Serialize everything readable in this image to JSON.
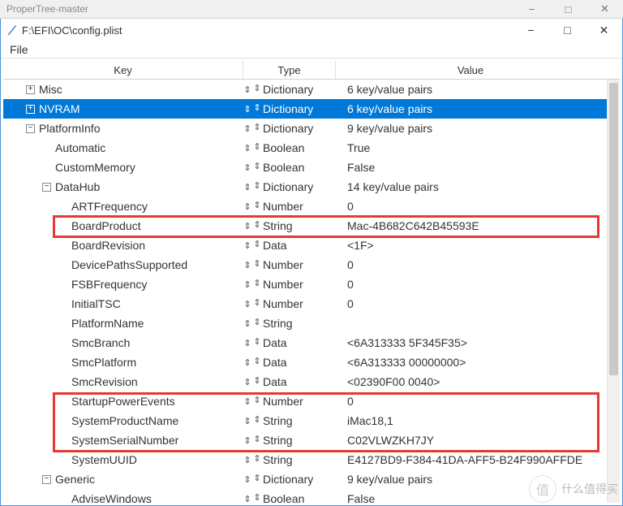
{
  "outer": {
    "title": "ProperTree-master"
  },
  "app": {
    "title": "F:\\EFI\\OC\\config.plist",
    "menu_file": "File"
  },
  "header": {
    "key": "Key",
    "type": "Type",
    "value": "Value"
  },
  "types": {
    "dict": "Dictionary",
    "bool": "Boolean",
    "str": "String",
    "num": "Number",
    "data": "Data"
  },
  "glyph": {
    "sort": "⇕",
    "menu": "≡",
    "plus": "+",
    "minus": "−",
    "min": "−",
    "sq": "□",
    "close": "✕"
  },
  "rows": [
    {
      "id": "misc",
      "indent": 1,
      "toggle": "plus",
      "label": "Misc",
      "type": "dict",
      "value": "6 key/value pairs"
    },
    {
      "id": "nvram",
      "indent": 1,
      "toggle": "plus",
      "label": "NVRAM",
      "type": "dict",
      "value": "6 key/value pairs",
      "selected": true
    },
    {
      "id": "platforminfo",
      "indent": 1,
      "toggle": "minus",
      "label": "PlatformInfo",
      "type": "dict",
      "value": "9 key/value pairs"
    },
    {
      "id": "automatic",
      "indent": 2,
      "toggle": "",
      "label": "Automatic",
      "type": "bool",
      "value": "True"
    },
    {
      "id": "custommemory",
      "indent": 2,
      "toggle": "",
      "label": "CustomMemory",
      "type": "bool",
      "value": "False"
    },
    {
      "id": "datahub",
      "indent": 2,
      "toggle": "minus",
      "label": "DataHub",
      "type": "dict",
      "value": "14 key/value pairs"
    },
    {
      "id": "artfreq",
      "indent": 3,
      "toggle": "",
      "label": "ARTFrequency",
      "type": "num",
      "value": "0"
    },
    {
      "id": "boardproduct",
      "indent": 3,
      "toggle": "",
      "label": "BoardProduct",
      "type": "str",
      "value": "Mac-4B682C642B45593E"
    },
    {
      "id": "boardrevision",
      "indent": 3,
      "toggle": "",
      "label": "BoardRevision",
      "type": "data",
      "value": "<1F>"
    },
    {
      "id": "dps",
      "indent": 3,
      "toggle": "",
      "label": "DevicePathsSupported",
      "type": "num",
      "value": "0"
    },
    {
      "id": "fsbfreq",
      "indent": 3,
      "toggle": "",
      "label": "FSBFrequency",
      "type": "num",
      "value": "0"
    },
    {
      "id": "initialtsc",
      "indent": 3,
      "toggle": "",
      "label": "InitialTSC",
      "type": "num",
      "value": "0"
    },
    {
      "id": "platformname",
      "indent": 3,
      "toggle": "",
      "label": "PlatformName",
      "type": "str",
      "value": ""
    },
    {
      "id": "smcbranch",
      "indent": 3,
      "toggle": "",
      "label": "SmcBranch",
      "type": "data",
      "value": "<6A313333 5F345F35>"
    },
    {
      "id": "smcplatform",
      "indent": 3,
      "toggle": "",
      "label": "SmcPlatform",
      "type": "data",
      "value": "<6A313333 00000000>"
    },
    {
      "id": "smcrevision",
      "indent": 3,
      "toggle": "",
      "label": "SmcRevision",
      "type": "data",
      "value": "<02390F00 0040>"
    },
    {
      "id": "startuppower",
      "indent": 3,
      "toggle": "",
      "label": "StartupPowerEvents",
      "type": "num",
      "value": "0"
    },
    {
      "id": "sysproductname",
      "indent": 3,
      "toggle": "",
      "label": "SystemProductName",
      "type": "str",
      "value": "iMac18,1"
    },
    {
      "id": "sysserial",
      "indent": 3,
      "toggle": "",
      "label": "SystemSerialNumber",
      "type": "str",
      "value": "C02VLWZKH7JY"
    },
    {
      "id": "sysuuid",
      "indent": 3,
      "toggle": "",
      "label": "SystemUUID",
      "type": "str",
      "value": "E4127BD9-F384-41DA-AFF5-B24F990AFFDE"
    },
    {
      "id": "generic",
      "indent": 2,
      "toggle": "minus",
      "label": "Generic",
      "type": "dict",
      "value": "9 key/value pairs"
    },
    {
      "id": "advisewindows",
      "indent": 3,
      "toggle": "",
      "label": "AdviseWindows",
      "type": "bool",
      "value": "False"
    }
  ],
  "watermark": {
    "icon": "值",
    "text": "什么值得买"
  }
}
